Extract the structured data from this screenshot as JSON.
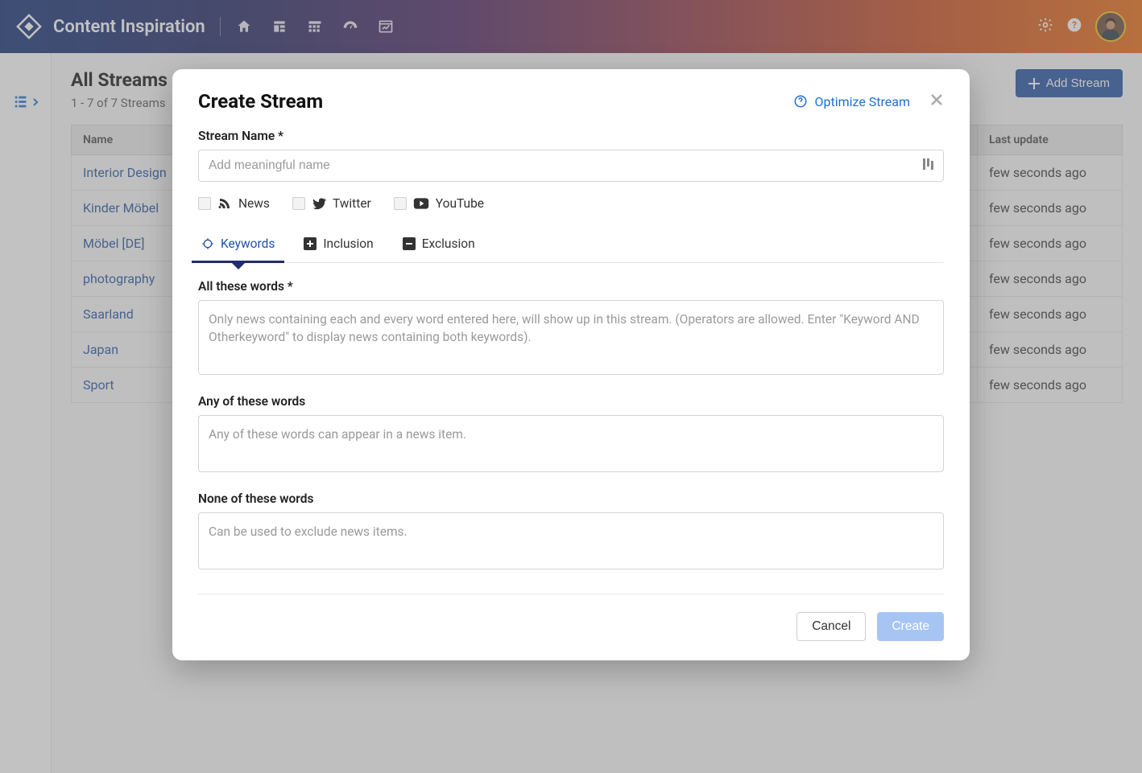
{
  "header": {
    "title": "Content Inspiration"
  },
  "page": {
    "title": "All Streams",
    "counter": "1 - 7 of 7 Streams",
    "add_button": "Add Stream"
  },
  "table": {
    "col_name": "Name",
    "col_update": "Last update",
    "rows": [
      {
        "name": "Interior Design",
        "update": "few seconds ago"
      },
      {
        "name": "Kinder Möbel",
        "update": "few seconds ago"
      },
      {
        "name": "Möbel [DE]",
        "update": "few seconds ago"
      },
      {
        "name": "photography",
        "update": "few seconds ago"
      },
      {
        "name": "Saarland",
        "update": "few seconds ago"
      },
      {
        "name": "Japan",
        "update": "few seconds ago"
      },
      {
        "name": "Sport",
        "update": "few seconds ago"
      }
    ]
  },
  "modal": {
    "title": "Create Stream",
    "optimize": "Optimize Stream",
    "stream_name_label": "Stream Name *",
    "stream_name_placeholder": "Add meaningful name",
    "sources": {
      "news": "News",
      "twitter": "Twitter",
      "youtube": "YouTube"
    },
    "tabs": {
      "keywords": "Keywords",
      "inclusion": "Inclusion",
      "exclusion": "Exclusion"
    },
    "all_words_label": "All these words *",
    "all_words_placeholder": "Only news containing each and every word entered here, will show up in this stream. (Operators are allowed. Enter \"Keyword AND Otherkeyword\" to display news containing both keywords).",
    "any_words_label": "Any of these words",
    "any_words_placeholder": "Any of these words can appear in a news item.",
    "none_words_label": "None of these words",
    "none_words_placeholder": "Can be used to exclude news items.",
    "cancel": "Cancel",
    "create": "Create"
  }
}
